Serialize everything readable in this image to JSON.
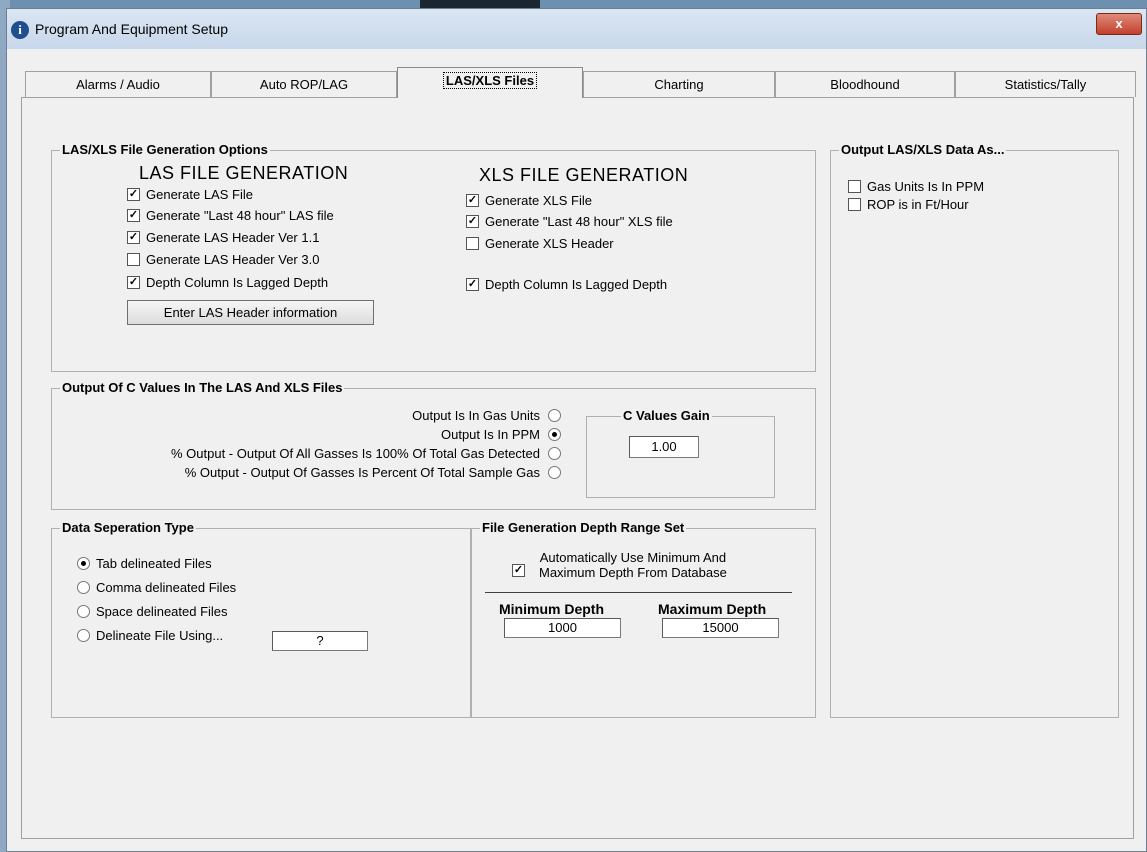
{
  "window": {
    "title": "Program And Equipment Setup",
    "close_glyph": "x"
  },
  "tabs": [
    {
      "label": "Alarms / Audio"
    },
    {
      "label": "Auto ROP/LAG"
    },
    {
      "label": "LAS/XLS Files"
    },
    {
      "label": "Charting"
    },
    {
      "label": "Bloodhound"
    },
    {
      "label": "Statistics/Tally"
    }
  ],
  "las_xls": {
    "group_title": "LAS/XLS File Generation Options",
    "las_heading": "LAS FILE GENERATION",
    "xls_heading": "XLS FILE GENERATION",
    "las_options": [
      {
        "label": "Generate LAS File",
        "checked": true
      },
      {
        "label": "Generate \"Last 48 hour\" LAS file",
        "checked": true
      },
      {
        "label": "Generate LAS Header Ver 1.1",
        "checked": true
      },
      {
        "label": "Generate LAS Header Ver 3.0",
        "checked": false
      },
      {
        "label": "Depth Column Is Lagged Depth",
        "checked": true
      }
    ],
    "las_header_button": "Enter LAS Header information",
    "xls_options": [
      {
        "label": "Generate XLS File",
        "checked": true
      },
      {
        "label": "Generate \"Last 48 hour\" XLS file",
        "checked": true
      },
      {
        "label": "Generate XLS Header",
        "checked": false
      }
    ],
    "xls_depth_option": {
      "label": "Depth Column Is Lagged Depth",
      "checked": true
    }
  },
  "output_as": {
    "group_title": "Output LAS/XLS Data As...",
    "options": [
      {
        "label": "Gas Units Is In PPM",
        "checked": false
      },
      {
        "label": "ROP is in Ft/Hour",
        "checked": false
      }
    ]
  },
  "c_values": {
    "group_title": "Output Of C Values In The LAS And XLS Files",
    "options": [
      {
        "label": "Output Is In Gas Units",
        "selected": false
      },
      {
        "label": "Output Is In PPM",
        "selected": true
      },
      {
        "label": "% Output - Output Of All Gasses Is 100% Of Total Gas Detected",
        "selected": false
      },
      {
        "label": "% Output - Output Of Gasses Is Percent Of Total Sample Gas",
        "selected": false
      }
    ],
    "gain_title": "C Values Gain",
    "gain_value": "1.00"
  },
  "separation": {
    "group_title": "Data Seperation Type",
    "options": [
      {
        "label": "Tab delineated Files",
        "selected": true
      },
      {
        "label": "Comma delineated Files",
        "selected": false
      },
      {
        "label": "Space delineated Files",
        "selected": false
      },
      {
        "label": "Delineate File Using...",
        "selected": false
      }
    ],
    "custom_value": "?"
  },
  "depth_range": {
    "group_title": "File Generation Depth Range Set",
    "auto_label_line1": "Automatically Use Minimum And",
    "auto_label_line2": "Maximum Depth From Database",
    "auto_checked": true,
    "min_label": "Minimum Depth",
    "max_label": "Maximum Depth",
    "min_value": "1000",
    "max_value": "15000"
  }
}
